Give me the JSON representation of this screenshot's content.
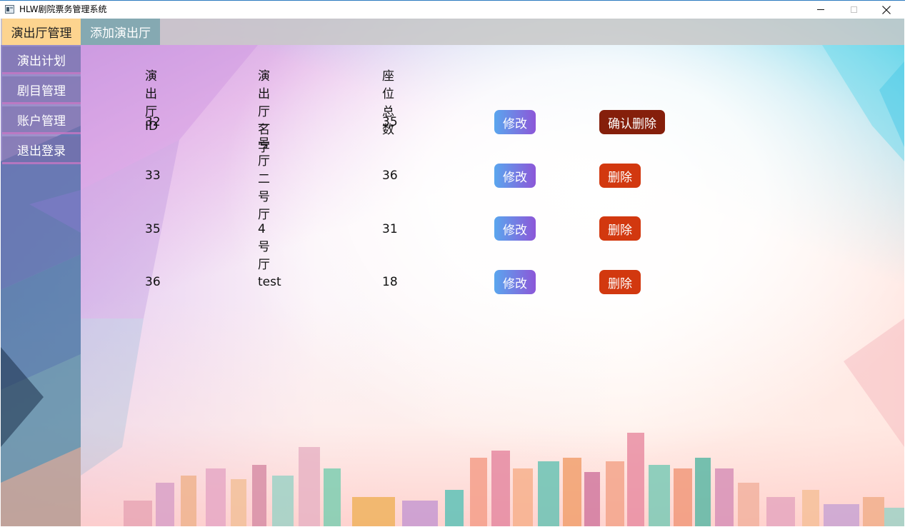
{
  "window": {
    "title": "HLW剧院票务管理系统",
    "minimize_symbol": "—",
    "maximize_symbol": "☐",
    "close_symbol": "✕"
  },
  "tabs": [
    {
      "label": "演出厅管理",
      "active": true
    },
    {
      "label": "添加演出厅",
      "active": false
    }
  ],
  "sidebar": {
    "items": [
      {
        "label": "演出计划"
      },
      {
        "label": "剧目管理"
      },
      {
        "label": "账户管理"
      },
      {
        "label": "退出登录"
      }
    ]
  },
  "table": {
    "headers": {
      "id": "演出厅ID",
      "name": "演出厅名字",
      "seats": "座位总数"
    },
    "rows": [
      {
        "id": "32",
        "name": "一号厅",
        "seats": "35",
        "edit_label": "修改",
        "delete_label": "确认删除",
        "delete_state": "confirm"
      },
      {
        "id": "33",
        "name": "二号厅",
        "seats": "36",
        "edit_label": "修改",
        "delete_label": "删除",
        "delete_state": "normal"
      },
      {
        "id": "35",
        "name": "4号厅",
        "seats": "31",
        "edit_label": "修改",
        "delete_label": "删除",
        "delete_state": "normal"
      },
      {
        "id": "36",
        "name": "test",
        "seats": "18",
        "edit_label": "修改",
        "delete_label": "删除",
        "delete_state": "normal"
      }
    ]
  },
  "colors": {
    "active_tab": "#fdd48f",
    "edit_gradient_start": "#5aa6ee",
    "edit_gradient_end": "#8c57d8",
    "delete": "#d2380f",
    "delete_confirm": "#851f0b"
  }
}
